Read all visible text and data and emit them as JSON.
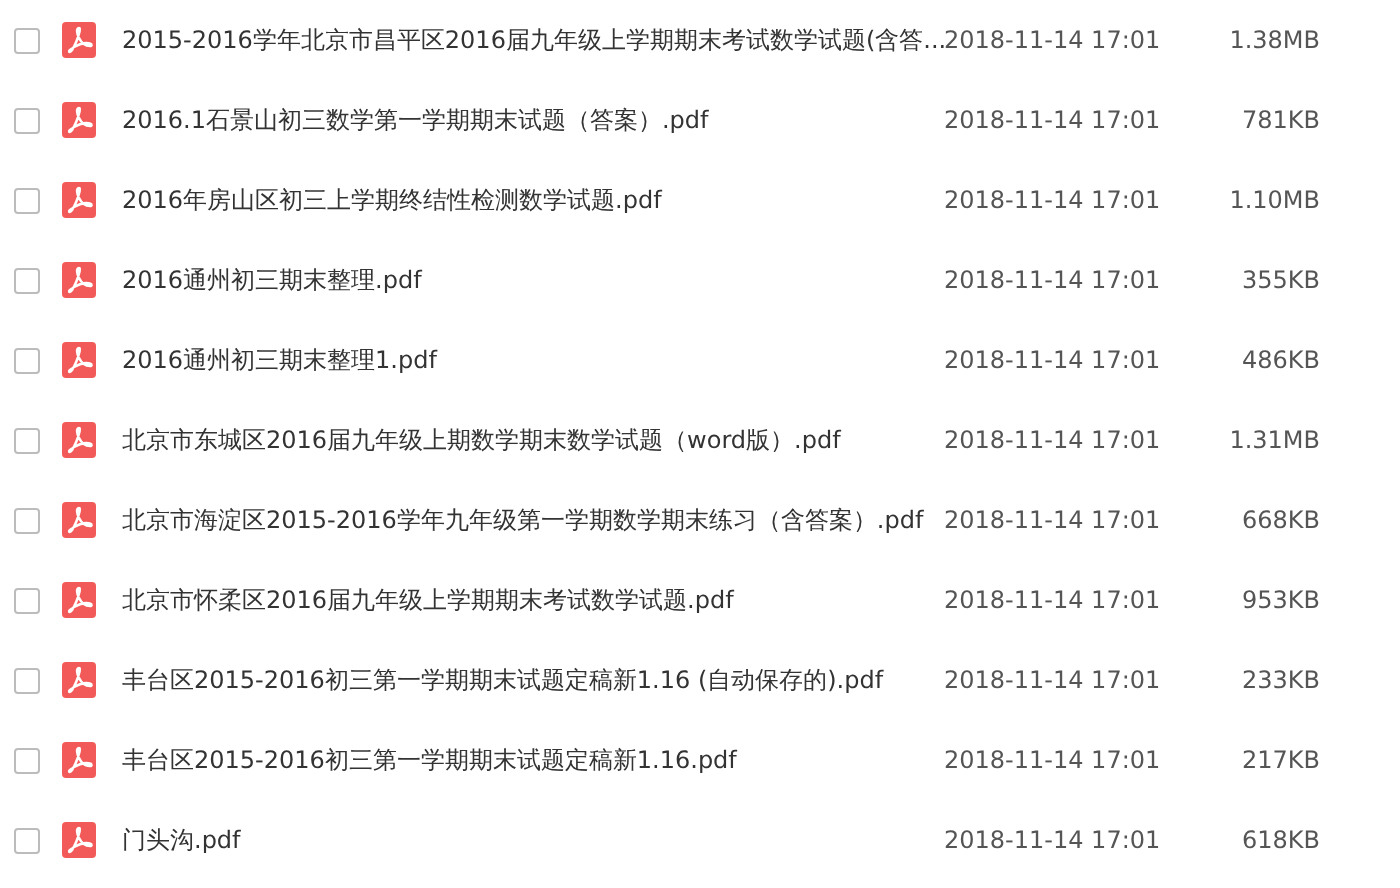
{
  "files": [
    {
      "name": "2015-2016学年北京市昌平区2016届九年级上学期期末考试数学试题(含答...",
      "date": "2018-11-14 17:01",
      "size": "1.38MB",
      "checked": false
    },
    {
      "name": "2016.1石景山初三数学第一学期期末试题（答案）.pdf",
      "date": "2018-11-14 17:01",
      "size": "781KB",
      "checked": false
    },
    {
      "name": "2016年房山区初三上学期终结性检测数学试题.pdf",
      "date": "2018-11-14 17:01",
      "size": "1.10MB",
      "checked": false
    },
    {
      "name": "2016通州初三期末整理.pdf",
      "date": "2018-11-14 17:01",
      "size": "355KB",
      "checked": false
    },
    {
      "name": "2016通州初三期末整理1.pdf",
      "date": "2018-11-14 17:01",
      "size": "486KB",
      "checked": false
    },
    {
      "name": "北京市东城区2016届九年级上期数学期末数学试题（word版）.pdf",
      "date": "2018-11-14 17:01",
      "size": "1.31MB",
      "checked": false
    },
    {
      "name": "北京市海淀区2015-2016学年九年级第一学期数学期末练习（含答案）.pdf",
      "date": "2018-11-14 17:01",
      "size": "668KB",
      "checked": false
    },
    {
      "name": "北京市怀柔区2016届九年级上学期期末考试数学试题.pdf",
      "date": "2018-11-14 17:01",
      "size": "953KB",
      "checked": false
    },
    {
      "name": "丰台区2015-2016初三第一学期期末试题定稿新1.16 (自动保存的).pdf",
      "date": "2018-11-14 17:01",
      "size": "233KB",
      "checked": false
    },
    {
      "name": "丰台区2015-2016初三第一学期期末试题定稿新1.16.pdf",
      "date": "2018-11-14 17:01",
      "size": "217KB",
      "checked": false
    },
    {
      "name": "门头沟.pdf",
      "date": "2018-11-14 17:01",
      "size": "618KB",
      "checked": false
    }
  ]
}
